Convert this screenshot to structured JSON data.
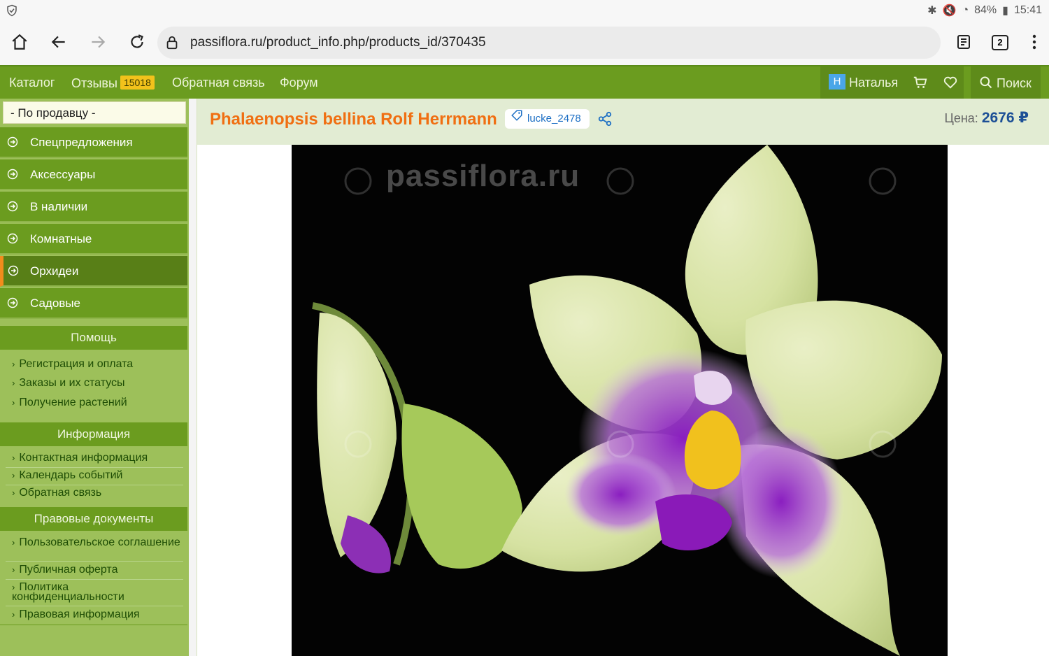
{
  "status": {
    "battery": "84%",
    "time": "15:41"
  },
  "browser": {
    "url": "passiflora.ru/product_info.php/products_id/370435",
    "tab_count": "2"
  },
  "nav": {
    "catalog": "Каталог",
    "reviews": "Отзывы",
    "reviews_count": "15018",
    "feedback": "Обратная связь",
    "forum": "Форум",
    "user_initial": "Н",
    "user_name": "Наталья",
    "search": "Поиск"
  },
  "sidebar": {
    "seller_filter": "- По продавцу -",
    "categories": [
      {
        "label": "Спецпредложения"
      },
      {
        "label": "Аксессуары"
      },
      {
        "label": "В наличии"
      },
      {
        "label": "Комнатные"
      },
      {
        "label": "Орхидеи"
      },
      {
        "label": "Садовые"
      }
    ],
    "help": {
      "title": "Помощь",
      "links": [
        "Регистрация и оплата",
        "Заказы и их статусы",
        "Получение растений"
      ]
    },
    "info": {
      "title": "Информация",
      "links": [
        "Контактная информация",
        "Календарь событий",
        "Обратная связь"
      ]
    },
    "legal": {
      "title": "Правовые документы",
      "links": [
        "Пользовательское соглашение",
        "Публичная оферта",
        "Политика конфиденциальности",
        "Правовая информация"
      ]
    }
  },
  "product": {
    "title": "Phalaenopsis bellina Rolf Herrmann",
    "seller_tag": "lucke_2478",
    "price_label": "Цена:",
    "price_value": "2676 ₽",
    "watermark": "passiflora.ru",
    "colors": {
      "accent": "#f06f12",
      "nav_green": "#6b9c1f",
      "price_blue": "#1c4f96"
    }
  }
}
